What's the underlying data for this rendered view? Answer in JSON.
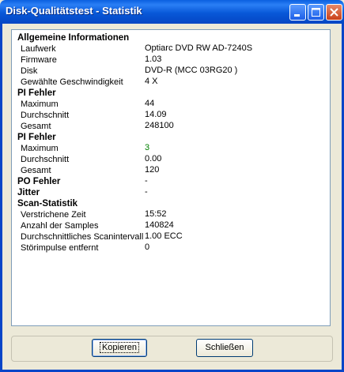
{
  "window": {
    "title": "Disk-Qualitätstest - Statistik"
  },
  "sections": {
    "general": {
      "heading": "Allgemeine Informationen",
      "rows": [
        {
          "label": "Laufwerk",
          "value": "Optiarc DVD RW AD-7240S"
        },
        {
          "label": "Firmware",
          "value": "1.03"
        },
        {
          "label": "Disk",
          "value": "DVD-R (MCC 03RG20  )"
        },
        {
          "label": "Gewählte Geschwindigkeit",
          "value": "4 X"
        }
      ]
    },
    "pi_errors": {
      "heading": "PI Fehler",
      "rows": [
        {
          "label": "Maximum",
          "value": "44"
        },
        {
          "label": "Durchschnitt",
          "value": "14.09"
        },
        {
          "label": "Gesamt",
          "value": "248100"
        }
      ]
    },
    "pi_failures": {
      "heading": "PI Fehler",
      "rows": [
        {
          "label": "Maximum",
          "value": "3"
        },
        {
          "label": "Durchschnitt",
          "value": "0.00"
        },
        {
          "label": "Gesamt",
          "value": "120"
        }
      ]
    },
    "po_errors": {
      "heading": "PO Fehler",
      "value": "-"
    },
    "jitter": {
      "heading": "Jitter",
      "value": "-"
    },
    "scan": {
      "heading": "Scan-Statistik",
      "rows": [
        {
          "label": "Verstrichene Zeit",
          "value": "15:52"
        },
        {
          "label": "Anzahl der Samples",
          "value": "140824"
        },
        {
          "label": "Durchschnittliches Scanintervall",
          "value": "1.00 ECC"
        },
        {
          "label": "Störimpulse entfernt",
          "value": "0"
        }
      ]
    }
  },
  "buttons": {
    "copy": "Kopieren",
    "close": "Schließen"
  },
  "colors": {
    "highlight_value": "#008000"
  }
}
